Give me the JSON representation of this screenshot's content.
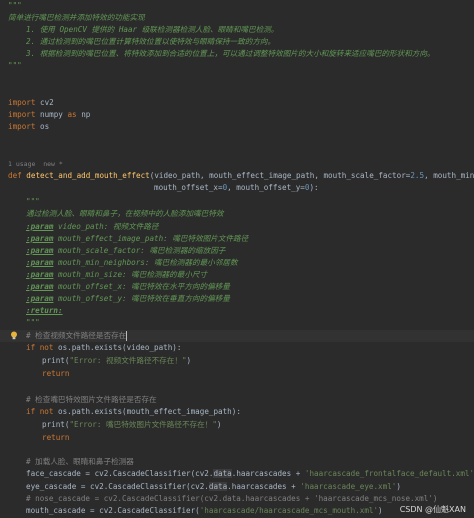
{
  "doc": {
    "open": "\"\"\"",
    "summary": "简单进行嘴巴检测并添加特效的功能实现",
    "steps": [
      "1. 使用 OpenCV 提供的 Haar 级联检测器检测人脸、眼睛和嘴巴检测。",
      "2. 通过检测到的嘴巴位置计算特效位置以使特效与眼睛保持一致的方向。",
      "3. 根据检测到的嘴巴位置、将特效添加到合适的位置上，可以通过调整特效图片的大小和旋转来适应嘴巴的形状和方向。"
    ],
    "close": "\"\"\""
  },
  "imports": [
    {
      "kw": "import",
      "name": "cv2"
    },
    {
      "kw": "import",
      "name": "numpy",
      "as": "as",
      "alias": "np"
    },
    {
      "kw": "import",
      "name": "os"
    }
  ],
  "usage_hint": "1 usage  new *",
  "def": {
    "kw": "def",
    "name": "detect_and_add_mouth_effect",
    "params1": "(video_path, mouth_effect_image_path, mouth_scale_factor=",
    "scale_val": "2.5",
    "params1b": ", mouth_min_n",
    "params2a": "mouth_offset_x=",
    "zero1": "0",
    "params2b": ", mouth_offset_y=",
    "zero2": "0",
    "params2c": "):"
  },
  "fdoc": {
    "open": "\"\"\"",
    "desc": "通过检测人脸、眼睛和鼻子，在视频中的人脸添加嘴巴特效",
    "params": [
      {
        "tag": ":param",
        "name": " video_path:",
        "text": " 视频文件路径"
      },
      {
        "tag": ":param",
        "name": " mouth_effect_image_path:",
        "text": " 嘴巴特效图片文件路径"
      },
      {
        "tag": ":param",
        "name": " mouth_scale_factor:",
        "text": " 嘴巴检测器的缩放因子"
      },
      {
        "tag": ":param",
        "name": " mouth_min_neighbors:",
        "text": " 嘴巴检测器的最小邻居数"
      },
      {
        "tag": ":param",
        "name": " mouth_min_size:",
        "text": " 嘴巴检测器的最小尺寸"
      },
      {
        "tag": ":param",
        "name": " mouth_offset_x:",
        "text": " 嘴巴特效在水平方向的偏移量"
      },
      {
        "tag": ":param",
        "name": " mouth_offset_y:",
        "text": " 嘴巴特效在垂直方向的偏移量"
      }
    ],
    "return_tag": ":return:",
    "close": "\"\"\""
  },
  "body": {
    "c1": "# 检查视频文件路径是否存在",
    "if1_a": "if not ",
    "if1_b": "os.path.exists(video_path):",
    "print1_a": "print(",
    "print1_s": "\"Error: 视频文件路径不存在！\"",
    "print1_b": ")",
    "ret1": "return",
    "c2": "# 检查嘴巴特效图片文件路径是否存在",
    "if2_a": "if not ",
    "if2_b": "os.path.exists(mouth_effect_image_path):",
    "print2_a": "print(",
    "print2_s": "\"Error: 嘴巴特效图片文件路径不存在！\"",
    "print2_b": ")",
    "ret2": "return",
    "c3": "# 加载人脸、眼睛和鼻子检测器",
    "face_a": "face_cascade = cv2.CascadeClassifier(cv2.",
    "face_data": "data",
    "face_b": ".haarcascades + ",
    "face_s": "'haarcascade_frontalface_default.xml'",
    "face_c": ")",
    "eye_a": "eye_cascade = cv2.CascadeClassifier(cv2.",
    "eye_data": "data",
    "eye_b": ".haarcascades + ",
    "eye_s": "'haarcascade_eye.xml'",
    "eye_c": ")",
    "nose": "# nose_cascade = cv2.CascadeClassifier(cv2.data.haarcascades + 'haarcascade_mcs_nose.xml')",
    "mouth_a": "mouth_cascade = cv2.CascadeClassifier(",
    "mouth_s": "'haarcascade/haarcascade_mcs_mouth.xml'",
    "mouth_c": ")"
  },
  "watermark": "CSDN @仙魁XAN"
}
